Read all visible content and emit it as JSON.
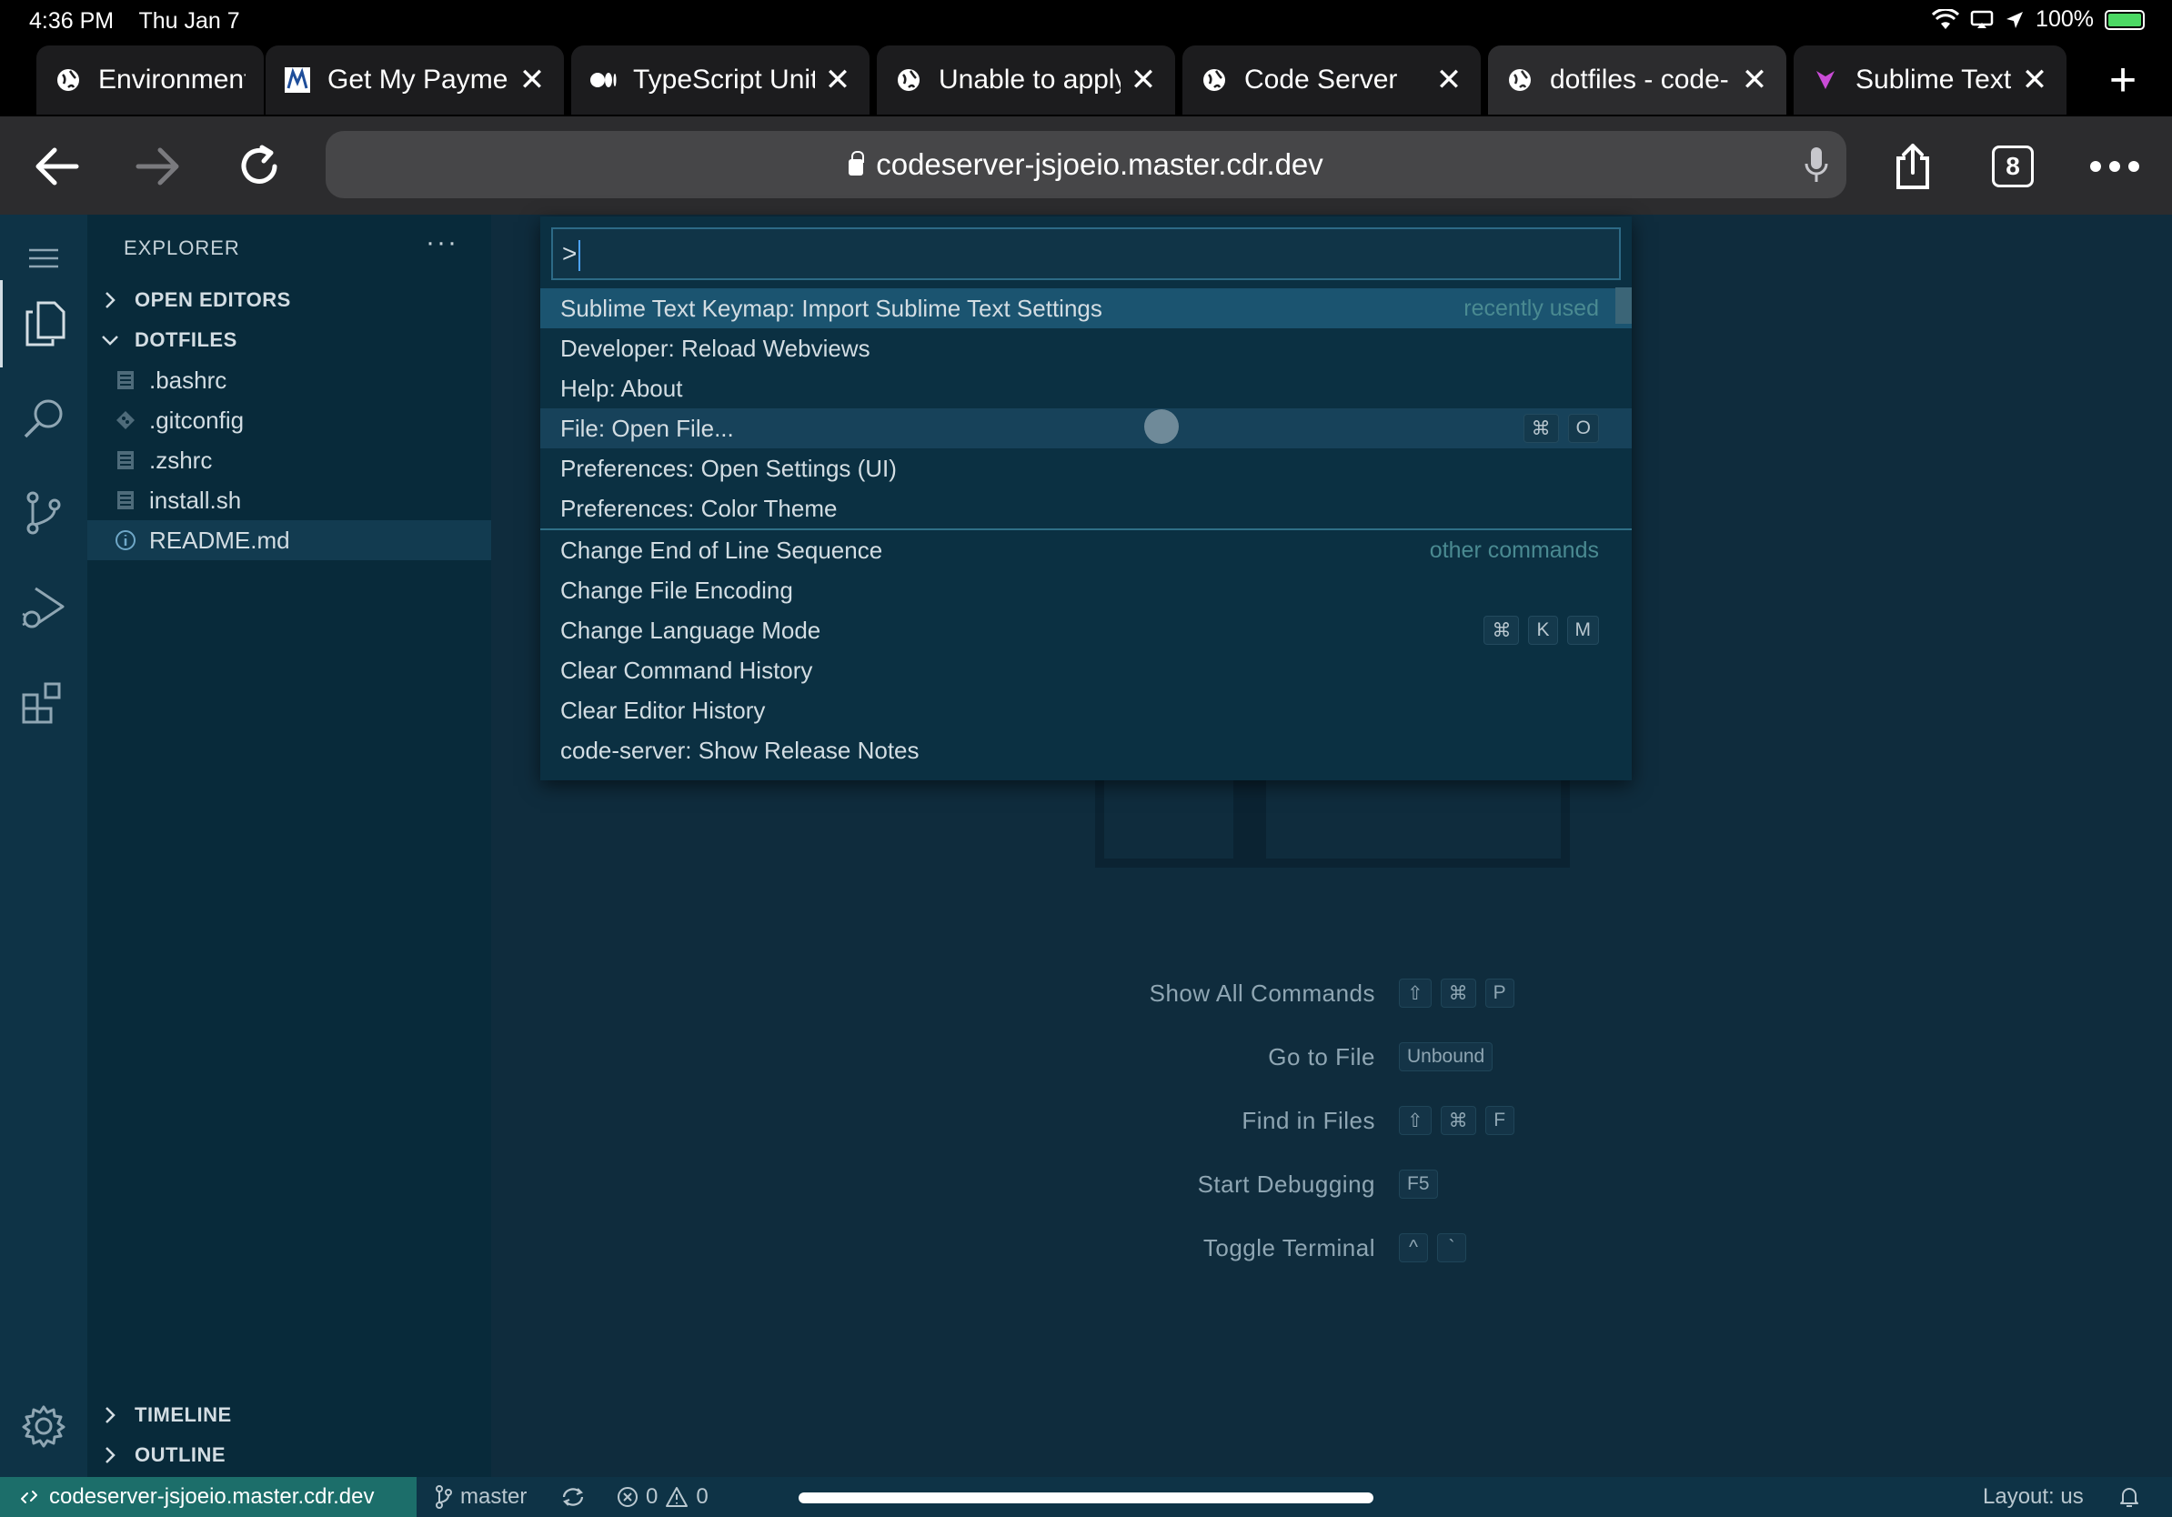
{
  "ios_status": {
    "time": "4:36 PM",
    "date": "Thu Jan 7",
    "battery": "100%"
  },
  "tabs": [
    {
      "title": "Environments",
      "icon": "globe-icon"
    },
    {
      "title": "Get My Paymen",
      "icon": "irs-favicon-icon"
    },
    {
      "title": "TypeScript Unit",
      "icon": "medium-favicon-icon"
    },
    {
      "title": "Unable to apply",
      "icon": "globe-icon"
    },
    {
      "title": "Code Server",
      "icon": "globe-icon"
    },
    {
      "title": "dotfiles - code-",
      "icon": "globe-icon",
      "active": true
    },
    {
      "title": "Sublime Text Ke",
      "icon": "sublime-favicon-icon"
    }
  ],
  "toolbar": {
    "url": "codeserver-jsjoeio.master.cdr.dev",
    "tab_count": "8"
  },
  "explorer": {
    "title": "EXPLORER",
    "open_editors": "OPEN EDITORS",
    "folder": "DOTFILES",
    "files": [
      ".bashrc",
      ".gitconfig",
      ".zshrc",
      "install.sh",
      "README.md"
    ],
    "timeline": "TIMELINE",
    "outline": "OUTLINE"
  },
  "palette": {
    "input": ">",
    "items": [
      {
        "label": "Sublime Text Keymap: Import Sublime Text Settings",
        "hint": "recently used"
      },
      {
        "label": "Developer: Reload Webviews"
      },
      {
        "label": "Help: About"
      },
      {
        "label": "File: Open File...",
        "keys": [
          "⌘",
          "O"
        ]
      },
      {
        "label": "Preferences: Open Settings (UI)"
      },
      {
        "label": "Preferences: Color Theme"
      },
      {
        "label": "Change End of Line Sequence",
        "hint": "other commands"
      },
      {
        "label": "Change File Encoding"
      },
      {
        "label": "Change Language Mode",
        "keys": [
          "⌘",
          "K",
          "M"
        ]
      },
      {
        "label": "Clear Command History"
      },
      {
        "label": "Clear Editor History"
      },
      {
        "label": "code-server: Show Release Notes"
      }
    ]
  },
  "hints": [
    {
      "label": "Show All Commands",
      "keys": [
        "⇧",
        "⌘",
        "P"
      ]
    },
    {
      "label": "Go to File",
      "keys": [
        "Unbound"
      ]
    },
    {
      "label": "Find in Files",
      "keys": [
        "⇧",
        "⌘",
        "F"
      ]
    },
    {
      "label": "Start Debugging",
      "keys": [
        "F5"
      ]
    },
    {
      "label": "Toggle Terminal",
      "keys": [
        "^",
        "`"
      ]
    }
  ],
  "status": {
    "remote": "codeserver-jsjoeio.master.cdr.dev",
    "branch": "master",
    "errors": "0",
    "warnings": "0",
    "layout": "Layout: us"
  },
  "colors": {
    "accent": "#1b5470",
    "remote_bg": "#1c6e6a",
    "background": "#0f2c3d"
  }
}
